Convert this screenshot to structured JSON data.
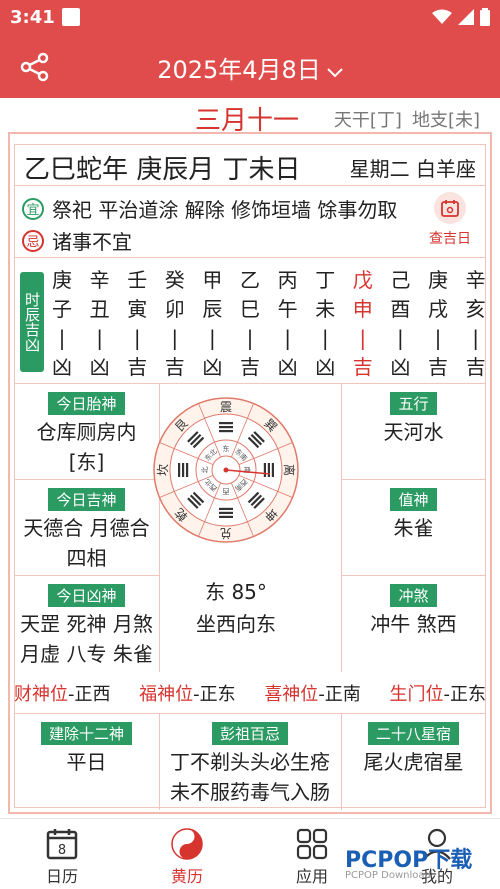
{
  "status_bar": {
    "time": "3:41"
  },
  "app_bar": {
    "date_title": "2025年4月8日"
  },
  "lunar": {
    "date": "三月十一",
    "tiangan": "天干[丁]",
    "dizhi": "地支[未]"
  },
  "header": {
    "ganzhi": "乙巳蛇年 庚辰月 丁未日",
    "weekday": "星期二 白羊座"
  },
  "yiji": {
    "yi_badge": "宜",
    "yi_text": "祭祀 平治道涂 解除 修饰垣墙 馀事勿取",
    "ji_badge": "忌",
    "ji_text": "诸事不宜",
    "lookup_label": "查吉日"
  },
  "hours": {
    "label": "时辰吉凶",
    "columns": [
      {
        "gan": "庚",
        "zhi": "子",
        "luck": "凶"
      },
      {
        "gan": "辛",
        "zhi": "丑",
        "luck": "凶"
      },
      {
        "gan": "壬",
        "zhi": "寅",
        "luck": "吉"
      },
      {
        "gan": "癸",
        "zhi": "卯",
        "luck": "吉"
      },
      {
        "gan": "甲",
        "zhi": "辰",
        "luck": "凶"
      },
      {
        "gan": "乙",
        "zhi": "巳",
        "luck": "吉"
      },
      {
        "gan": "丙",
        "zhi": "午",
        "luck": "凶"
      },
      {
        "gan": "丁",
        "zhi": "未",
        "luck": "凶"
      },
      {
        "gan": "戊",
        "zhi": "申",
        "luck": "吉"
      },
      {
        "gan": "己",
        "zhi": "酉",
        "luck": "凶"
      },
      {
        "gan": "庚",
        "zhi": "戌",
        "luck": "吉"
      },
      {
        "gan": "辛",
        "zhi": "亥",
        "luck": "吉"
      }
    ],
    "active_index": 8
  },
  "grid": {
    "taishen": {
      "tag": "今日胎神",
      "line1": "仓库厕房内",
      "line2": "[东]"
    },
    "wuxing": {
      "tag": "五行",
      "line1": "天河水"
    },
    "jishen": {
      "tag": "今日吉神",
      "line1": "天德合 月德合",
      "line2": "四相"
    },
    "zhishen": {
      "tag": "值神",
      "line1": "朱雀"
    },
    "xiongshen": {
      "tag": "今日凶神",
      "line1": "天罡 死神 月煞",
      "line2": "月虚 八专 朱雀"
    },
    "chongsha": {
      "tag": "冲煞",
      "line1": "冲牛 煞西"
    },
    "compass": {
      "trigrams": [
        "震",
        "巽",
        "离",
        "坤",
        "兑",
        "乾",
        "坎",
        "艮"
      ],
      "inner": [
        "东",
        "东南",
        "南",
        "西南",
        "西",
        "西北",
        "北",
        "东北"
      ],
      "direction": "东 85°",
      "facing": "坐西向东"
    }
  },
  "god_positions": [
    {
      "label": "财神位",
      "value": "-正西"
    },
    {
      "label": "福神位",
      "value": "-正东"
    },
    {
      "label": "喜神位",
      "value": "-正南"
    },
    {
      "label": "生门位",
      "value": "-正东"
    }
  ],
  "bottom": {
    "jianchu": {
      "tag": "建除十二神",
      "line1": "平日"
    },
    "pengzu": {
      "tag": "彭祖百忌",
      "line1": "丁不剃头头必生疮",
      "line2": "未不服药毒气入肠"
    },
    "xingxiu": {
      "tag": "二十八星宿",
      "line1": "尾火虎宿星"
    }
  },
  "nav": {
    "items": [
      {
        "label": "日历",
        "icon": "calendar-icon",
        "day": "8"
      },
      {
        "label": "黄历",
        "icon": "yinyang-icon"
      },
      {
        "label": "应用",
        "icon": "apps-grid-icon"
      },
      {
        "label": "我的",
        "icon": "user-icon"
      }
    ],
    "active_index": 1
  },
  "watermark": {
    "text": "PCPOP下载",
    "sub": "PCPOP Download"
  },
  "colors": {
    "primary": "#e04b4b",
    "accent_red": "#d6342f",
    "green": "#2c9b63",
    "border": "#f3c4bd"
  }
}
